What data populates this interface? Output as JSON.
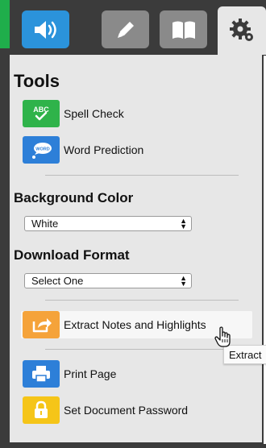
{
  "toolbar": {
    "tabs": [
      {
        "name": "audio",
        "icon": "speaker-icon",
        "active": false,
        "color": "#2b93db"
      },
      {
        "name": "annotate",
        "icon": "pencil-icon",
        "active": false,
        "color": "#8a8a8a"
      },
      {
        "name": "reader",
        "icon": "book-icon",
        "active": false,
        "color": "#8a8a8a"
      },
      {
        "name": "settings",
        "icon": "gear-icon",
        "active": true,
        "color": "#e7e7e7"
      }
    ]
  },
  "tools": {
    "title": "Tools",
    "spell_check": {
      "label": "Spell Check",
      "icon": "abc-check-icon",
      "icon_text": "ABC",
      "color": "#2fb34a"
    },
    "word_prediction": {
      "label": "Word Prediction",
      "icon": "word-bubble-icon",
      "icon_text": "WORD",
      "color": "#2d7fd8"
    }
  },
  "background_color": {
    "title": "Background Color",
    "selected": "White"
  },
  "download_format": {
    "title": "Download Format",
    "selected": "Select One"
  },
  "actions": {
    "extract": {
      "label": "Extract Notes and Highlights",
      "icon": "export-icon",
      "color": "#f5a33a"
    },
    "print": {
      "label": "Print Page",
      "icon": "printer-icon",
      "color": "#2d7fd8"
    },
    "password": {
      "label": "Set Document Password",
      "icon": "lock-icon",
      "color": "#f5c518"
    }
  },
  "tooltip": {
    "text": "Extract"
  }
}
